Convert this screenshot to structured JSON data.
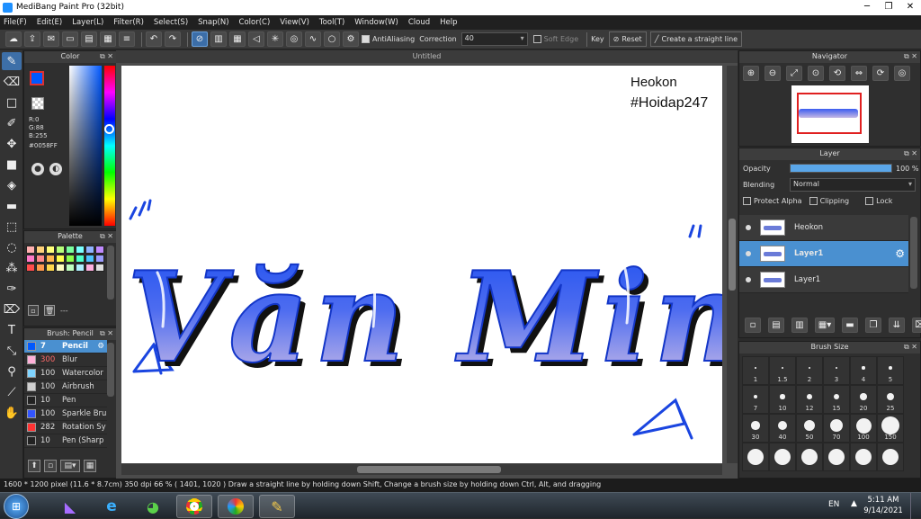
{
  "window": {
    "title": "MediBang Paint Pro (32bit)",
    "controls": [
      "─",
      "❐",
      "✕"
    ]
  },
  "menu": [
    "File(F)",
    "Edit(E)",
    "Layer(L)",
    "Filter(R)",
    "Select(S)",
    "Snap(N)",
    "Color(C)",
    "View(V)",
    "Tool(T)",
    "Window(W)",
    "Cloud",
    "Help"
  ],
  "toolbar": {
    "antialiasing_label": "AntiAliasing",
    "correction_label": "Correction",
    "correction_value": "40",
    "soft_edge_label": "Soft Edge",
    "key_label": "Key",
    "reset_label": "Reset",
    "straight_line_label": "Create a straight line"
  },
  "color_panel": {
    "title": "Color",
    "r": "R:0",
    "g": "G:88",
    "b": "B:255",
    "hex": "#0058FF",
    "fg_color": "#0058ff"
  },
  "palette": {
    "title": "Palette",
    "dash": "---",
    "colors": [
      "#ffb0b0",
      "#ffd27a",
      "#ffff7a",
      "#b6ff7a",
      "#7aff9e",
      "#7affff",
      "#8fb3ff",
      "#c08aff",
      "#ff7ac8",
      "#ff8a8a",
      "#ffb84d",
      "#ffff4d",
      "#8cff4d",
      "#4dffcc",
      "#4dc3ff",
      "#9c9cff",
      "#ff4d4d",
      "#ff9a4d",
      "#ffd84d",
      "#fffec0",
      "#c0ffc0",
      "#b0f0ff",
      "#ffb0e0",
      "#e0e0e0"
    ]
  },
  "brush_panel": {
    "title": "Brush: Pencil",
    "items": [
      {
        "size": "7",
        "name": "Pencil",
        "color": "#0058ff",
        "selected": true
      },
      {
        "size": "300",
        "name": "Blur",
        "color": "#ffb0d8"
      },
      {
        "size": "100",
        "name": "Watercolor",
        "color": "#7fd4ff"
      },
      {
        "size": "100",
        "name": "Airbrush",
        "color": "#cfcfcf"
      },
      {
        "size": "10",
        "name": "Pen",
        "color": "#222222"
      },
      {
        "size": "100",
        "name": "Sparkle Bru",
        "color": "#3355ff"
      },
      {
        "size": "282",
        "name": "Rotation Sy",
        "color": "#ff3333"
      },
      {
        "size": "10",
        "name": "Pen (Sharp",
        "color": "#222222"
      }
    ]
  },
  "canvas": {
    "tab_title": "Untitled",
    "text_line1": "Heokon",
    "text_line2": "#Hoidap247",
    "lettering": "Văn Minh lãy"
  },
  "navigator": {
    "title": "Navigator"
  },
  "layer_panel": {
    "title": "Layer",
    "opacity_label": "Opacity",
    "opacity_value": "100 %",
    "opacity_fraction": 1.0,
    "blending_label": "Blending",
    "blending_value": "Normal",
    "protect_alpha": "Protect Alpha",
    "clipping": "Clipping",
    "lock": "Lock",
    "layers": [
      {
        "name": "Heokon",
        "selected": false
      },
      {
        "name": "Layer1",
        "selected": true
      },
      {
        "name": "Layer1",
        "selected": false
      }
    ]
  },
  "brush_size": {
    "title": "Brush Size",
    "sizes": [
      "1",
      "1.5",
      "2",
      "3",
      "4",
      "5",
      "7",
      "10",
      "12",
      "15",
      "20",
      "25",
      "30",
      "40",
      "50",
      "70",
      "100",
      "150",
      "",
      "",
      "",
      "",
      "",
      ""
    ]
  },
  "status": {
    "text": "1600 * 1200 pixel   (11.6 * 8.7cm)   350 dpi   66 %   ( 1401, 1020 )   Draw a straight line by holding down Shift, Change a brush size by holding down Ctrl, Alt, and dragging"
  },
  "taskbar": {
    "lang": "EN",
    "time": "5:11 AM",
    "date": "9/14/2021"
  }
}
